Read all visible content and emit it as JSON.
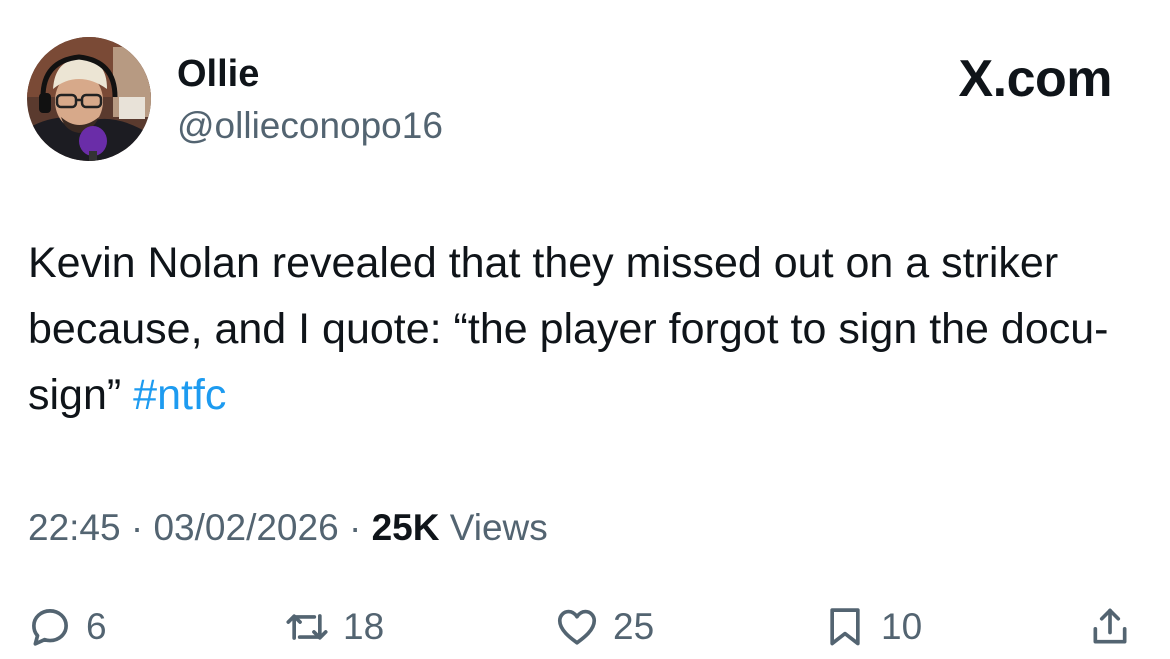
{
  "author": {
    "display_name": "Ollie",
    "handle": "@ollieconopo16"
  },
  "brand": {
    "label": "X.com",
    "color": "#0f1419"
  },
  "tweet": {
    "text": "Kevin Nolan revealed that they missed out on a striker because, and I quote: “the player forgot to sign the docu-sign” ",
    "hashtag": "#ntfc",
    "hashtag_color": "#1d9bf0"
  },
  "meta": {
    "time": "22:45",
    "separator": " · ",
    "date": "03/02/2026",
    "views_count": "25K",
    "views_label": " Views"
  },
  "actions": {
    "reply": {
      "icon": "reply-icon",
      "count": "6"
    },
    "repost": {
      "icon": "repost-icon",
      "count": "18"
    },
    "like": {
      "icon": "heart-icon",
      "count": "25"
    },
    "bookmark": {
      "icon": "bookmark-icon",
      "count": "10"
    },
    "share": {
      "icon": "share-icon"
    }
  },
  "colors": {
    "text_primary": "#0f1419",
    "text_secondary": "#536471",
    "accent": "#1d9bf0"
  }
}
